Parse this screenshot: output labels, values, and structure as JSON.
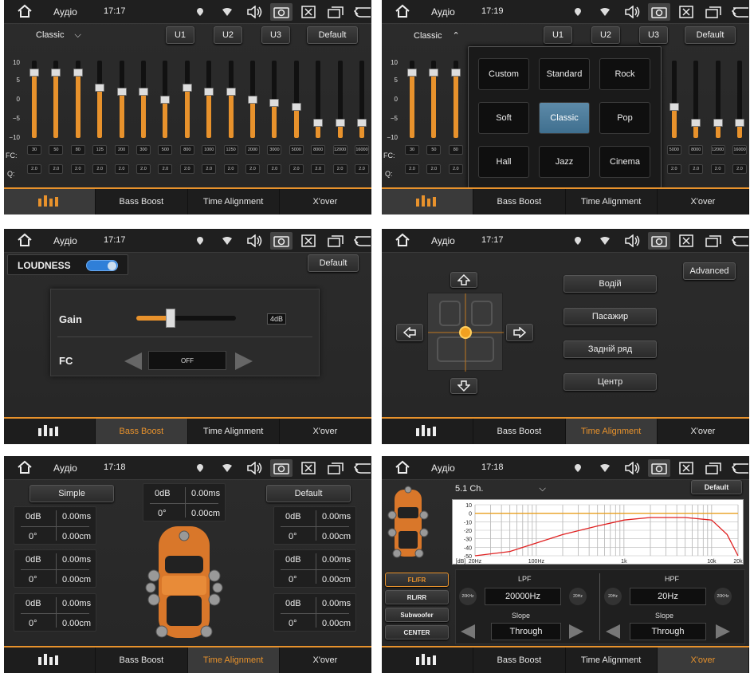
{
  "status": {
    "panel1": {
      "title": "Аудіо",
      "time": "17:17"
    },
    "panel2": {
      "title": "Аудіо",
      "time": "17:19"
    },
    "panel3": {
      "title": "Аудіо",
      "time": "17:17"
    },
    "panel4": {
      "title": "Аудіо",
      "time": "17:17"
    },
    "panel5": {
      "title": "Аудіо",
      "time": "17:18"
    },
    "panel6": {
      "title": "Аудіо",
      "time": "17:18"
    }
  },
  "tabs": {
    "bass_boost": "Bass Boost",
    "time_alignment": "Time Alignment",
    "xover": "X'over"
  },
  "eq": {
    "preset": "Classic",
    "u1": "U1",
    "u2": "U2",
    "u3": "U3",
    "default": "Default",
    "y_labels": [
      "10",
      "5",
      "0",
      "−5",
      "−10"
    ],
    "fc_label": "FC:",
    "q_label": "Q:",
    "fc": [
      "30",
      "50",
      "80",
      "125",
      "200",
      "300",
      "500",
      "800",
      "1000",
      "1250",
      "2000",
      "3000",
      "5000",
      "8000",
      "12000",
      "16000"
    ],
    "q": [
      "2.0",
      "2.0",
      "2.0",
      "2.0",
      "2.0",
      "2.0",
      "2.0",
      "2.0",
      "2.0",
      "2.0",
      "2.0",
      "2.0",
      "2.0",
      "2.0",
      "2.0",
      "2.0"
    ],
    "levels": [
      7,
      7,
      7,
      3,
      2,
      2,
      0,
      3,
      2,
      2,
      0,
      -1,
      -2,
      -6,
      -6,
      -6
    ]
  },
  "presets": {
    "items": [
      "Custom",
      "Standard",
      "Rock",
      "Soft",
      "Classic",
      "Pop",
      "Hall",
      "Jazz",
      "Cinema"
    ],
    "selected": "Classic"
  },
  "bass": {
    "loudness": "LOUDNESS",
    "loudness_on": true,
    "default": "Default",
    "gain_label": "Gain",
    "gain_value": "4dB",
    "gain_fraction": 0.34,
    "fc_label": "FC",
    "fc_value": "OFF"
  },
  "position": {
    "advanced": "Advanced",
    "options": [
      "Водій",
      "Пасажир",
      "Задній ряд",
      "Центр"
    ]
  },
  "alignment": {
    "simple": "Simple",
    "default": "Default",
    "center": {
      "db": "0dB",
      "ms": "0.00ms",
      "deg": "0°",
      "cm": "0.00cm"
    },
    "boxes": [
      {
        "db": "0dB",
        "ms": "0.00ms",
        "deg": "0°",
        "cm": "0.00cm"
      },
      {
        "db": "0dB",
        "ms": "0.00ms",
        "deg": "0°",
        "cm": "0.00cm"
      },
      {
        "db": "0dB",
        "ms": "0.00ms",
        "deg": "0°",
        "cm": "0.00cm"
      },
      {
        "db": "0dB",
        "ms": "0.00ms",
        "deg": "0°",
        "cm": "0.00cm"
      },
      {
        "db": "0dB",
        "ms": "0.00ms",
        "deg": "0°",
        "cm": "0.00cm"
      },
      {
        "db": "0dB",
        "ms": "0.00ms",
        "deg": "0°",
        "cm": "0.00cm"
      }
    ]
  },
  "xover": {
    "mode": "5.1 Ch.",
    "default": "Default",
    "channels": [
      "FL/FR",
      "RL/RR",
      "Subwoofer",
      "CENTER"
    ],
    "selected_channel": "FL/FR",
    "lpf": "LPF",
    "hpf": "HPF",
    "lpf_value": "20000Hz",
    "hpf_value": "20Hz",
    "lpf_left": "20KHz",
    "lpf_right": "20Hz",
    "hpf_left": "20Hz",
    "hpf_right": "20KHz",
    "slope": "Slope",
    "lpf_slope": "Through",
    "hpf_slope": "Through",
    "chart_data": {
      "type": "line",
      "y_ticks": [
        "10",
        "0",
        "-10",
        "-20",
        "-30",
        "-40",
        "-50"
      ],
      "x_ticks": [
        "[dB]",
        "20Hz",
        "100Hz",
        "1k",
        "10k",
        "20k"
      ],
      "ylim": [
        -50,
        10
      ],
      "series": [
        {
          "color": "#e8a020",
          "x": [
            20,
            20000
          ],
          "y": [
            0,
            0
          ]
        },
        {
          "color": "#e02020",
          "x": [
            20,
            50,
            100,
            200,
            500,
            1000,
            2000,
            5000,
            10000,
            15000,
            20000
          ],
          "y": [
            -50,
            -45,
            -35,
            -25,
            -15,
            -8,
            -5,
            -5,
            -8,
            -25,
            -50
          ]
        }
      ]
    }
  },
  "colors": {
    "accent": "#e8922c",
    "selected_preset": "#5d8aa8",
    "toggle": "#2f7fd8"
  }
}
